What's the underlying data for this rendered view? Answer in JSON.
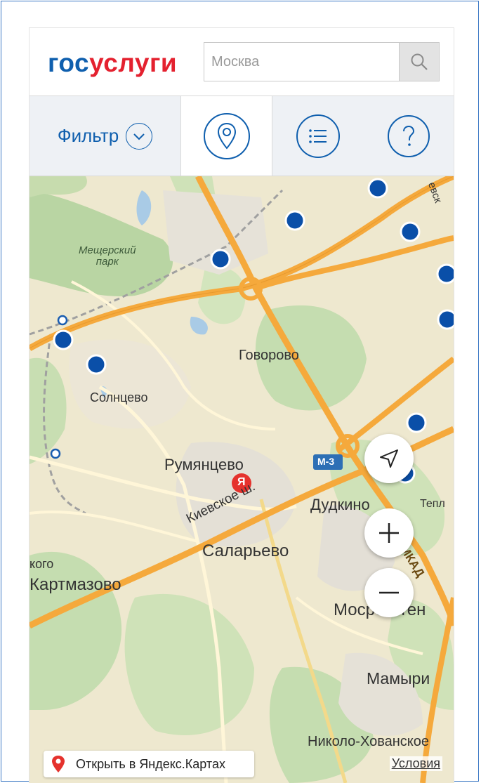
{
  "header": {
    "logo_part1": "гос",
    "logo_part2": "услуги",
    "search": {
      "placeholder": "Москва",
      "value": ""
    }
  },
  "tabs": {
    "filter_label": "Фильтр"
  },
  "map": {
    "labels": {
      "park_line1": "Мещерский",
      "park_line2": "парк",
      "govorovo": "Говорово",
      "solntsevo": "Солнцево",
      "rumyantsevo": "Румянцево",
      "kievskoe": "Киевское ш.",
      "dudkino": "Дудкино",
      "salaryevo": "Саларьево",
      "kartmazovo": "Картмазово",
      "kogo": "кого",
      "mosrentgen": "Мосрентген",
      "mamyri": "Мамыри",
      "nikolo": "Николо-Хованское",
      "tepl": "Тепл",
      "mkad": "МКАД",
      "evsk": "евск",
      "m3": "М-3",
      "yandex_badge": "Я"
    },
    "open_yandex": "Открыть в Яндекс.Картах",
    "terms": "Условия"
  },
  "colors": {
    "brand_blue": "#0f5fae",
    "brand_red": "#e4212f",
    "marker_blue": "#0a4fa8",
    "road_orange": "#f5a93c"
  }
}
